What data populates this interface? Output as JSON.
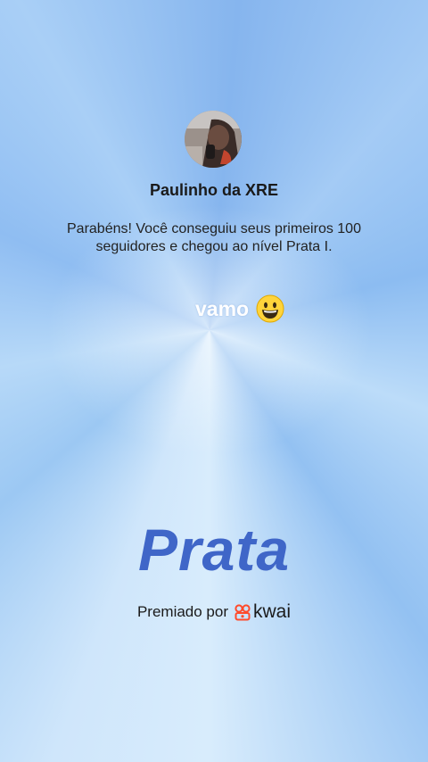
{
  "user": {
    "name": "Paulinho da XRE",
    "avatar_icon": "profile-photo"
  },
  "message": "Parabéns! Você conseguiu seus primeiros 100 seguidores e chegou ao nível Prata I.",
  "caption": {
    "text": "vamo",
    "emoji_icon": "grinning-face-emoji"
  },
  "level": "Prata",
  "footer": {
    "label": "Premiado por",
    "brand": "kwai",
    "brand_icon": "kwai-logo-icon",
    "brand_color": "#ff4a2b"
  },
  "colors": {
    "background_primary": "#9cc8f3",
    "level_text": "#3f66c8"
  }
}
